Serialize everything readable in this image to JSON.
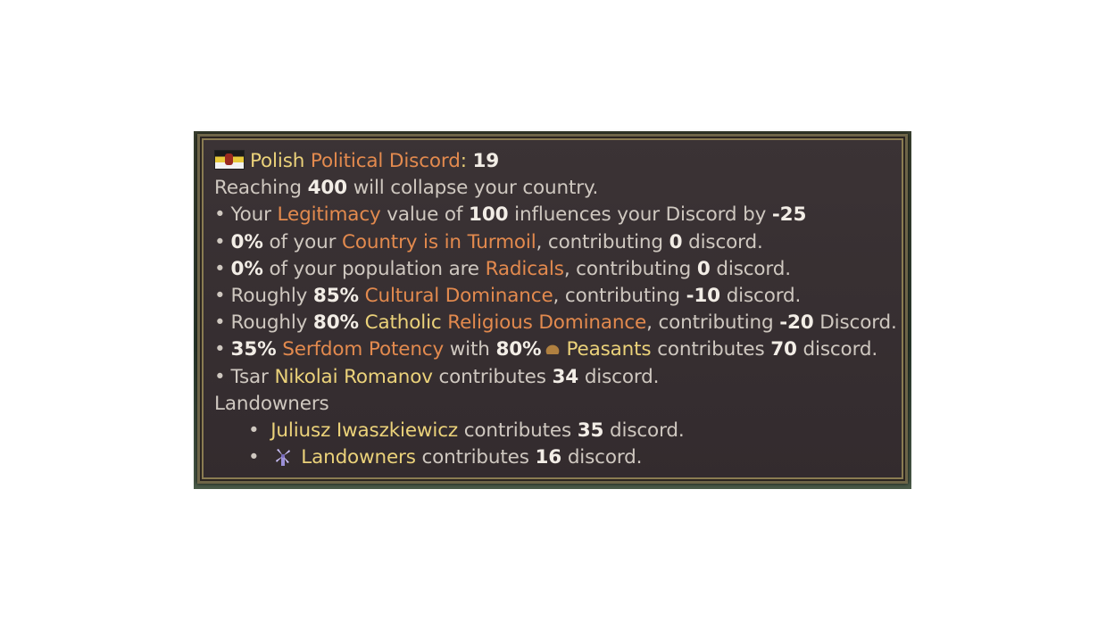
{
  "tooltip": {
    "title": {
      "country": "Polish",
      "term": "Political Discord",
      "colon": ":",
      "value": "19"
    },
    "warning": {
      "pre": "Reaching",
      "value": "400",
      "post": "will collapse your country."
    },
    "legitimacy": {
      "bullet": "•",
      "pre": "Your",
      "term": "Legitimacy",
      "mid": "value of",
      "value": "100",
      "post": "influences your Discord by",
      "delta": "-25"
    },
    "turmoil": {
      "bullet": "•",
      "pct": "0%",
      "pre": "of your",
      "term": "Country is in Turmoil",
      "mid": ", contributing",
      "value": "0",
      "post": "discord."
    },
    "radicals": {
      "bullet": "•",
      "pct": "0%",
      "pre": "of your population are",
      "term": "Radicals",
      "mid": ", contributing",
      "value": "0",
      "post": "discord."
    },
    "cultural": {
      "bullet": "•",
      "pre": "Roughly",
      "pct": "85%",
      "term": "Cultural Dominance",
      "mid": ", contributing",
      "value": "-10",
      "post": "discord."
    },
    "religious": {
      "bullet": "•",
      "pre": "Roughly",
      "pct": "80%",
      "faith": "Catholic",
      "term": "Religious Dominance",
      "mid": ", contributing",
      "value": "-20",
      "post": "Discord."
    },
    "serfdom": {
      "bullet": "•",
      "pct": "35%",
      "term": "Serfdom Potency",
      "mid": "with",
      "pct2": "80%",
      "pop": "Peasants",
      "post1": "contributes",
      "value": "70",
      "post2": "discord."
    },
    "ruler": {
      "bullet": "•",
      "title": "Tsar",
      "name": "Nikolai Romanov",
      "mid": "contributes",
      "value": "34",
      "post": "discord."
    },
    "group_header": "Landowners",
    "group_items": [
      {
        "bullet": "•",
        "name": "Juliusz Iwaszkiewicz",
        "mid": "contributes",
        "value": "35",
        "post": "discord."
      },
      {
        "bullet": "•",
        "name": "Landowners",
        "mid": "contributes",
        "value": "16",
        "post": "discord.",
        "icon": "windmill-icon"
      }
    ]
  },
  "colors": {
    "text": "#cfc8c0",
    "bold": "#f2ede6",
    "term_orange": "#e38a4e",
    "name_yellow": "#ebd27a",
    "panel_bg": "#372f31",
    "frame_gold": "#8a7c52"
  }
}
